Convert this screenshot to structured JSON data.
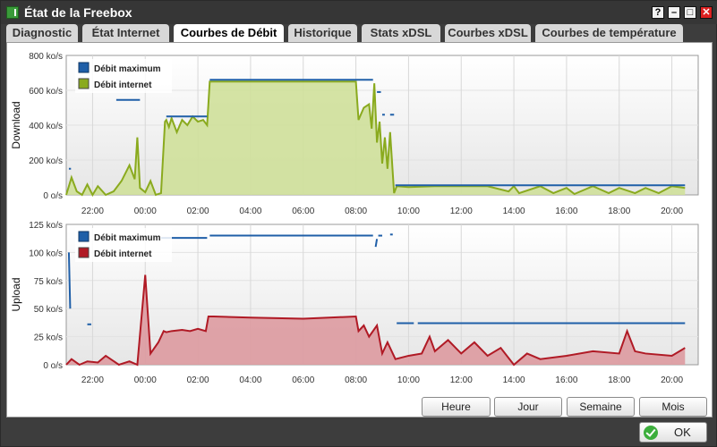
{
  "window": {
    "title": "État de la Freebox",
    "controls": [
      "?",
      "–",
      "□",
      "✕"
    ]
  },
  "tabs": [
    {
      "label": "Diagnostic",
      "active": false
    },
    {
      "label": "État Internet",
      "active": false
    },
    {
      "label": "Courbes de Débit",
      "active": true
    },
    {
      "label": "Historique",
      "active": false
    },
    {
      "label": "Stats xDSL",
      "active": false
    },
    {
      "label": "Courbes xDSL",
      "active": false
    },
    {
      "label": "Courbes de température",
      "active": false
    }
  ],
  "range_buttons": {
    "hour": "Heure",
    "day": "Jour",
    "week": "Semaine",
    "month": "Mois"
  },
  "ok_label": "OK",
  "colors": {
    "max_line": "#1f5fa8",
    "download_line": "#8aaa1e",
    "download_fill": "#cfe09a",
    "upload_line": "#b01a25",
    "upload_fill": "#dd9aa0"
  },
  "chart_data": [
    {
      "type": "area",
      "ylabel": "Download",
      "ylim": [
        0,
        800
      ],
      "yticks": [
        "0 o/s",
        "200 ko/s",
        "400 ko/s",
        "600 ko/s",
        "800 ko/s"
      ],
      "xlim": [
        -3,
        21
      ],
      "xticks": [
        "22:00",
        "00:00",
        "02:00",
        "04:00",
        "06:00",
        "08:00",
        "10:00",
        "12:00",
        "14:00",
        "16:00",
        "18:00",
        "20:00"
      ],
      "legend": [
        "Débit maximum",
        "Débit internet"
      ],
      "series": [
        {
          "name": "Débit maximum",
          "segments": [
            [
              [
                -2.9,
                150
              ],
              [
                -2.82,
                150
              ]
            ],
            [
              [
                -1.1,
                545
              ],
              [
                -0.2,
                545
              ]
            ],
            [
              [
                0.8,
                450
              ],
              [
                2.35,
                450
              ]
            ],
            [
              [
                2.45,
                660
              ],
              [
                8.65,
                660
              ]
            ],
            [
              [
                8.8,
                590
              ],
              [
                8.95,
                590
              ]
            ],
            [
              [
                9.0,
                460
              ],
              [
                9.1,
                460
              ]
            ],
            [
              [
                9.3,
                460
              ],
              [
                9.45,
                460
              ]
            ],
            [
              [
                9.5,
                55
              ],
              [
                20.5,
                55
              ]
            ]
          ]
        },
        {
          "name": "Débit internet",
          "x": [
            -3,
            -2.8,
            -2.6,
            -2.4,
            -2.2,
            -2.0,
            -1.8,
            -1.5,
            -1.2,
            -0.9,
            -0.6,
            -0.4,
            -0.3,
            -0.2,
            0.0,
            0.2,
            0.4,
            0.6,
            0.75,
            0.8,
            0.9,
            1.0,
            1.2,
            1.4,
            1.6,
            1.8,
            2.0,
            2.2,
            2.35,
            2.45,
            2.6,
            3.0,
            4.0,
            5.0,
            6.0,
            7.0,
            8.0,
            8.1,
            8.3,
            8.5,
            8.6,
            8.7,
            8.8,
            8.9,
            9.0,
            9.1,
            9.2,
            9.3,
            9.45,
            9.55,
            10.0,
            11.0,
            12.0,
            13.0,
            13.8,
            14.0,
            14.2,
            15.0,
            15.5,
            16.0,
            16.3,
            17.0,
            17.6,
            18.0,
            18.6,
            19.0,
            19.5,
            20.0,
            20.5
          ],
          "values": [
            0,
            100,
            20,
            0,
            60,
            0,
            50,
            0,
            20,
            80,
            170,
            90,
            330,
            40,
            15,
            80,
            0,
            10,
            420,
            430,
            390,
            440,
            360,
            430,
            400,
            450,
            420,
            430,
            400,
            650,
            650,
            650,
            650,
            650,
            650,
            650,
            650,
            430,
            500,
            520,
            380,
            640,
            300,
            420,
            180,
            330,
            150,
            360,
            10,
            50,
            45,
            50,
            50,
            50,
            20,
            50,
            10,
            50,
            10,
            40,
            5,
            50,
            10,
            40,
            10,
            40,
            10,
            50,
            40
          ]
        }
      ]
    },
    {
      "type": "area",
      "ylabel": "Upload",
      "ylim": [
        0,
        125
      ],
      "yticks": [
        "0 o/s",
        "25 ko/s",
        "50 ko/s",
        "75 ko/s",
        "100 ko/s",
        "125 ko/s"
      ],
      "xlim": [
        -3,
        21
      ],
      "xticks": [
        "22:00",
        "00:00",
        "02:00",
        "04:00",
        "06:00",
        "08:00",
        "10:00",
        "12:00",
        "14:00",
        "16:00",
        "18:00",
        "20:00"
      ],
      "legend": [
        "Débit maximum",
        "Débit internet"
      ],
      "series": [
        {
          "name": "Débit maximum",
          "segments": [
            [
              [
                -2.9,
                100
              ],
              [
                -2.85,
                50
              ]
            ],
            [
              [
                -2.2,
                36
              ],
              [
                -2.05,
                36
              ]
            ],
            [
              [
                0.6,
                113
              ],
              [
                2.35,
                113
              ]
            ],
            [
              [
                2.45,
                115
              ],
              [
                8.65,
                115
              ]
            ],
            [
              [
                8.75,
                105
              ],
              [
                8.8,
                112
              ]
            ],
            [
              [
                8.85,
                115
              ],
              [
                9.0,
                115
              ]
            ],
            [
              [
                9.3,
                116
              ],
              [
                9.4,
                116
              ]
            ],
            [
              [
                9.55,
                37
              ],
              [
                10.2,
                37
              ]
            ],
            [
              [
                10.35,
                37
              ],
              [
                20.5,
                37
              ]
            ]
          ]
        },
        {
          "name": "Débit internet",
          "x": [
            -3,
            -2.8,
            -2.5,
            -2.2,
            -1.8,
            -1.5,
            -1.0,
            -0.6,
            -0.3,
            0.0,
            0.2,
            0.5,
            0.7,
            0.8,
            1.0,
            1.4,
            1.7,
            2.0,
            2.3,
            2.4,
            2.6,
            4.0,
            6.0,
            8.0,
            8.1,
            8.3,
            8.5,
            8.8,
            9.0,
            9.2,
            9.5,
            10.0,
            10.5,
            10.8,
            11.0,
            11.5,
            12.0,
            12.5,
            13.0,
            13.5,
            14.0,
            14.5,
            15.0,
            16.0,
            17.0,
            18.0,
            18.3,
            18.6,
            19.0,
            20.0,
            20.5
          ],
          "values": [
            0,
            5,
            0,
            3,
            2,
            8,
            0,
            3,
            0,
            80,
            10,
            20,
            30,
            29,
            30,
            31,
            30,
            32,
            30,
            43,
            43,
            42,
            41,
            43,
            30,
            35,
            25,
            35,
            10,
            20,
            5,
            8,
            10,
            25,
            12,
            22,
            10,
            20,
            8,
            15,
            0,
            10,
            5,
            8,
            12,
            10,
            30,
            12,
            10,
            8,
            15
          ]
        }
      ]
    }
  ]
}
